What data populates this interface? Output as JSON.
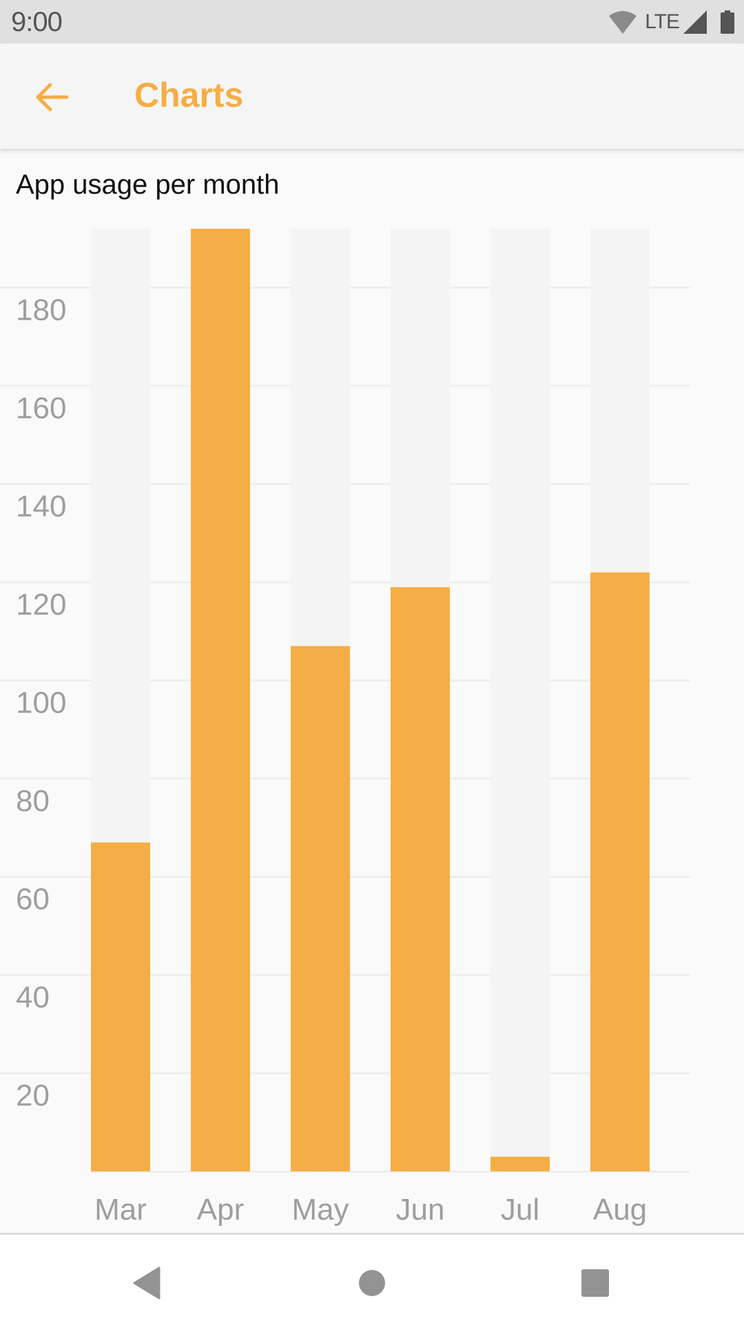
{
  "status_bar": {
    "time": "9:00",
    "network_label": "LTE",
    "icons": [
      "wifi-icon",
      "signal-icon",
      "battery-icon"
    ]
  },
  "app_bar": {
    "title": "Charts",
    "back_icon": "arrow-back-icon",
    "accent_color": "#f4ae45"
  },
  "nav_bar": {
    "icons": [
      "nav-back-icon",
      "nav-home-icon",
      "nav-recents-icon"
    ]
  },
  "colors": {
    "bar": "#f4ae45",
    "bar_track": "#f4f4f4",
    "grid": "#eeeeee",
    "tick_label": "#9e9e9e"
  },
  "chart_data": {
    "type": "bar",
    "title": "App usage per month",
    "xlabel": "",
    "ylabel": "",
    "categories": [
      "Mar",
      "Apr",
      "May",
      "Jun",
      "Jul",
      "Aug"
    ],
    "values": [
      67,
      192,
      107,
      119,
      3,
      122
    ],
    "track_max": 192,
    "ylim": [
      0,
      192
    ],
    "yticks": [
      20,
      40,
      60,
      80,
      100,
      120,
      140,
      160,
      180
    ],
    "grid": true,
    "legend": "none"
  }
}
